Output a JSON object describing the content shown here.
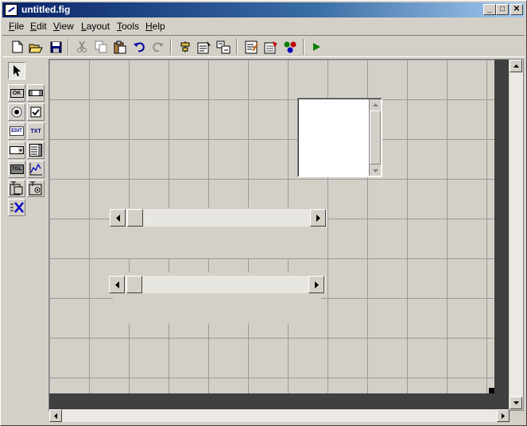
{
  "window": {
    "title": "untitled.fig",
    "controls": {
      "minimize": "_",
      "maximize": "□",
      "close": "✕"
    }
  },
  "menu": {
    "items": [
      {
        "key": "file",
        "accel": "F",
        "rest": "ile"
      },
      {
        "key": "edit",
        "accel": "E",
        "rest": "dit"
      },
      {
        "key": "view",
        "accel": "V",
        "rest": "iew"
      },
      {
        "key": "layout",
        "accel": "L",
        "rest": "ayout"
      },
      {
        "key": "tools",
        "accel": "T",
        "rest": "ools"
      },
      {
        "key": "help",
        "accel": "H",
        "rest": "elp"
      }
    ]
  },
  "toolbar": {
    "icons": [
      "new-icon",
      "open-icon",
      "save-icon",
      "cut-icon",
      "copy-icon",
      "paste-icon",
      "undo-icon",
      "redo-icon",
      "align-icon",
      "menu-editor-icon",
      "tab-order-icon",
      "mfile-editor-icon",
      "property-inspector-icon",
      "object-browser-icon",
      "run-icon"
    ]
  },
  "palette": {
    "labels": {
      "push": "OK",
      "edit": "EDIT",
      "text": "TXT",
      "toggle": "TGL"
    }
  },
  "colors": {
    "title_active": "#0a246a",
    "face": "#d4d0c8",
    "canvas_border": "#404040",
    "run_green": "#008000"
  }
}
